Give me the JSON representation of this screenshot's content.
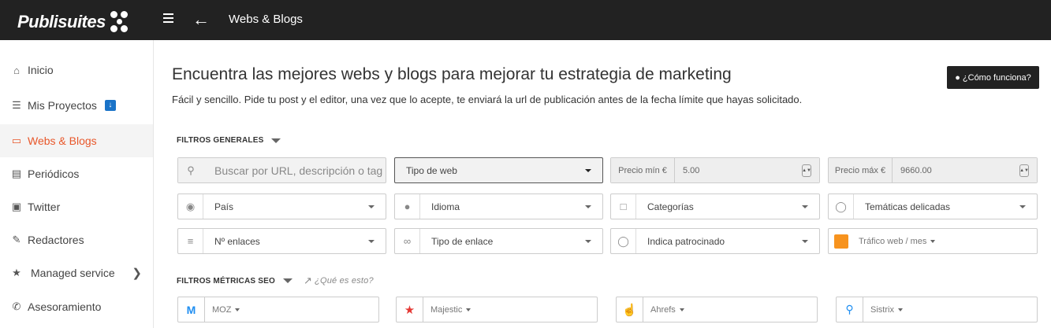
{
  "topbar": {
    "logo": "Publisuites",
    "title": "Webs & Blogs"
  },
  "sidebar": {
    "items": [
      {
        "label": "Inicio",
        "icon": "home-icon"
      },
      {
        "label": "Mis Proyectos",
        "icon": "list-icon"
      },
      {
        "label": "Webs & Blogs",
        "icon": "laptop-icon",
        "active": true
      },
      {
        "label": "Periódicos",
        "icon": "newspaper-icon"
      },
      {
        "label": "Twitter",
        "icon": "twitter-icon"
      },
      {
        "label": "Redactores",
        "icon": "pencil-icon"
      },
      {
        "label": "Managed service",
        "icon": "star-icon"
      },
      {
        "label": "Asesoramiento",
        "icon": "phone-icon"
      }
    ]
  },
  "main": {
    "heading": "Encuentra las mejores webs y blogs para mejorar tu estrategia de marketing",
    "subheading": "Fácil y sencillo. Pide tu post y el editor, una vez que lo acepte, te enviará la url de publicación antes de la fecha límite que hayas solicitado.",
    "how_button": "¿Cómo funciona?",
    "filters_general_label": "FILTROS GENERALES",
    "search_placeholder": "Buscar por URL, descripción o tag",
    "tipo_web": "Tipo de web",
    "precio_min_label": "Precio mín €",
    "precio_min_value": "5.00",
    "precio_max_label": "Precio máx €",
    "precio_max_value": "9660.00",
    "pais": "País",
    "idioma": "Idioma",
    "categorias": "Categorías",
    "tematicas": "Temáticas delicadas",
    "enlaces": "Nº enlaces",
    "tipo_enlace": "Tipo de enlace",
    "patrocinado": "Indica patrocinado",
    "trafico": "Tráfico web / mes",
    "filters_seo_label": "FILTROS MÉTRICAS SEO",
    "seo_help": "¿Qué es esto?",
    "moz": "MOZ",
    "majestic": "Majestic",
    "ahrefs": "Ahrefs",
    "sistrix": "Sistrix"
  },
  "colors": {
    "topbar": "#222222",
    "accent": "#e8572a",
    "badge": "#1a73c8"
  }
}
